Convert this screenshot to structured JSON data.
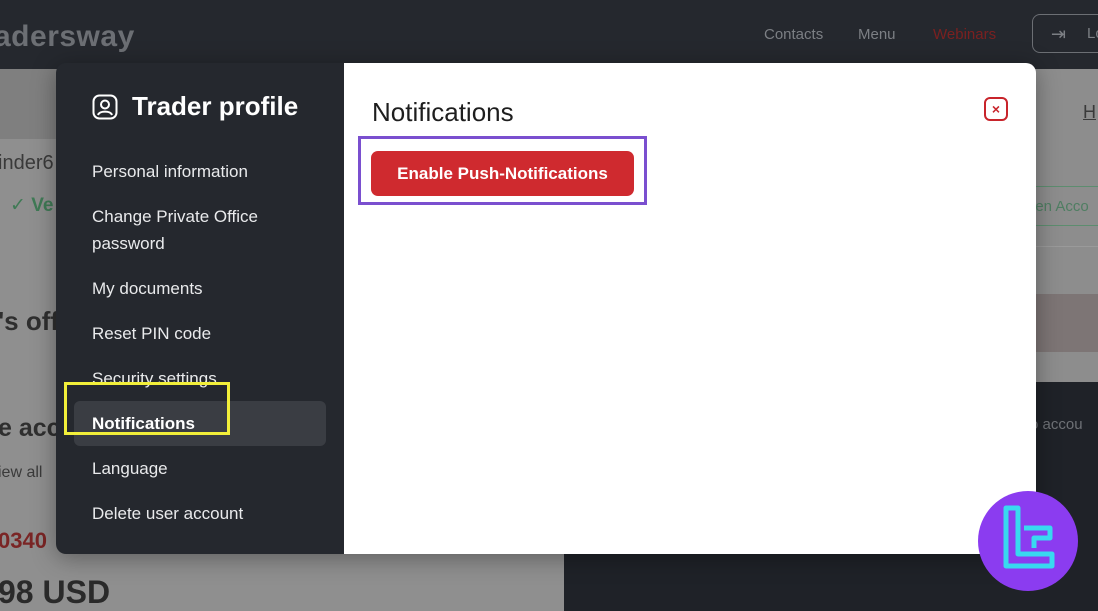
{
  "background": {
    "logo": "adersway",
    "nav": {
      "contacts": "Contacts",
      "menu": "Menu",
      "webinars": "Webinars"
    },
    "login_label": "Lo",
    "fragments": {
      "left_1": "inder6",
      "left_2": "✓ Ve",
      "left_3": "'s off",
      "left_4": "e acc",
      "left_5": "iew all",
      "left_6": "0340",
      "left_7": "98 USD",
      "right_1": "H",
      "right_2": "pen Acco",
      "right_3": "o accou"
    }
  },
  "sidebar": {
    "title": "Trader profile",
    "items": [
      {
        "label": "Personal information",
        "active": false
      },
      {
        "label": "Change Private Office password",
        "active": false
      },
      {
        "label": "My documents",
        "active": false
      },
      {
        "label": "Reset PIN code",
        "active": false
      },
      {
        "label": "Security settings",
        "active": false
      },
      {
        "label": "Notifications",
        "active": true
      },
      {
        "label": "Language",
        "active": false
      },
      {
        "label": "Delete user account",
        "active": false
      }
    ]
  },
  "content": {
    "title": "Notifications",
    "push_button_label": "Enable Push-Notifications",
    "close_symbol": "×"
  },
  "colors": {
    "accent_red": "#cf2a2f",
    "sidebar_bg": "#25282e",
    "highlight_purple": "#7a4fcf",
    "highlight_yellow": "#f2ef3a",
    "watermark_purple": "#8b3cf0",
    "watermark_cyan": "#38d9f0"
  }
}
